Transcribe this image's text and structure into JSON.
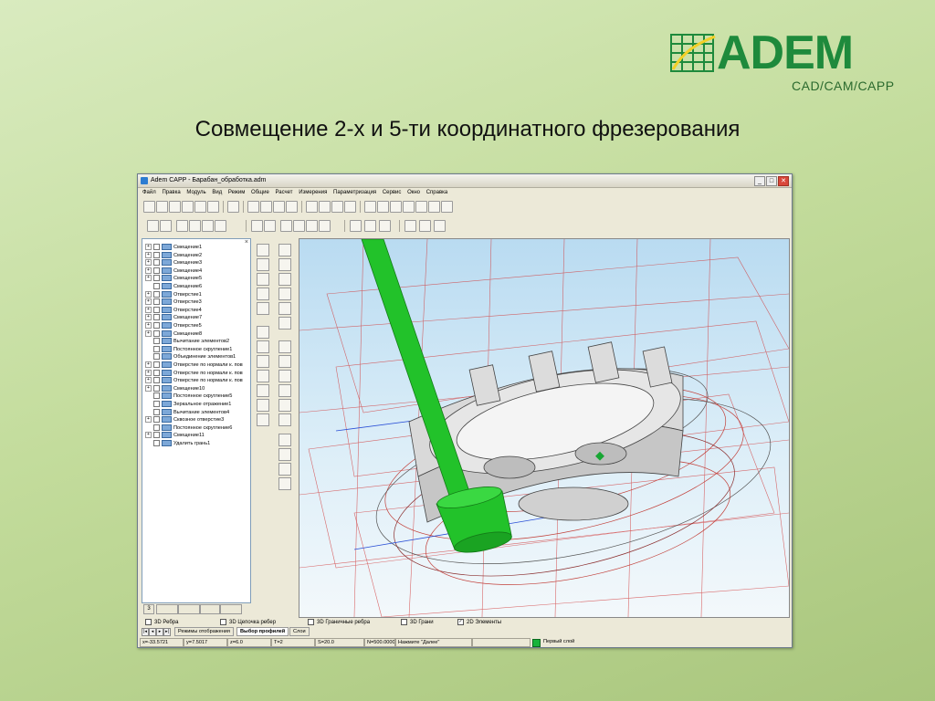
{
  "logo": {
    "name": "ADEM",
    "subtitle": "CAD/CAM/CAPP",
    "brand_color": "#1e8a3c"
  },
  "slide_title": "Совмещение 2-х и 5-ти координатного фрезерования",
  "window": {
    "title": "Adem CAPP - Барабан_обработка.adm",
    "controls": [
      "_",
      "□",
      "✕"
    ]
  },
  "menu": [
    "Файл",
    "Правка",
    "Модуль",
    "Вид",
    "Режим",
    "Общие",
    "Расчет",
    "Измерения",
    "Параметризация",
    "Сервис",
    "Окно",
    "Справка"
  ],
  "tree": {
    "items": [
      {
        "label": "Смещение1",
        "expandable": true
      },
      {
        "label": "Смещение2",
        "expandable": true
      },
      {
        "label": "Смещение3",
        "expandable": true
      },
      {
        "label": "Смещение4",
        "expandable": true
      },
      {
        "label": "Смещение5",
        "expandable": true
      },
      {
        "label": "Смещение6",
        "expandable": false
      },
      {
        "label": "Отверстие1",
        "expandable": true
      },
      {
        "label": "Отверстие3",
        "expandable": true
      },
      {
        "label": "Отверстие4",
        "expandable": true
      },
      {
        "label": "Смещение7",
        "expandable": true
      },
      {
        "label": "Отверстие5",
        "expandable": true
      },
      {
        "label": "Смещение8",
        "expandable": true
      },
      {
        "label": "Вычитание элементов2",
        "expandable": false
      },
      {
        "label": "Постоянное скругление1",
        "expandable": false
      },
      {
        "label": "Объединение элементов1",
        "expandable": false
      },
      {
        "label": "Отверстие по нормали к. пов",
        "expandable": true
      },
      {
        "label": "Отверстие по нормали к. пов",
        "expandable": true
      },
      {
        "label": "Отверстие по нормали к. пов",
        "expandable": true
      },
      {
        "label": "Смещение10",
        "expandable": true
      },
      {
        "label": "Постоянное скругление5",
        "expandable": false
      },
      {
        "label": "Зеркальное отражение1",
        "expandable": false
      },
      {
        "label": "Вычитание элементов4",
        "expandable": false
      },
      {
        "label": "Сквозное отверстие3",
        "expandable": true
      },
      {
        "label": "Постоянное скругление6",
        "expandable": false
      },
      {
        "label": "Смещение11",
        "expandable": true
      },
      {
        "label": "Удалить грань1",
        "expandable": false
      }
    ],
    "tab_label": "3"
  },
  "filters": [
    {
      "label": "3D Ребра",
      "checked": false
    },
    {
      "label": "3D Цепочка ребер",
      "checked": false
    },
    {
      "label": "3D Граничные ребра",
      "checked": false
    },
    {
      "label": "3D Грани",
      "checked": false
    },
    {
      "label": "2D Элементы",
      "checked": true
    }
  ],
  "view_tabs": [
    "Режимы отображения",
    "Выбор профилей",
    "Слои"
  ],
  "status": {
    "x": "x=-33.5721",
    "y": "y=7.5017",
    "z": "z=6.0",
    "t": "T=2",
    "s": "S=20.0",
    "n": "N=500.0000",
    "hint": "Нажмите \"Далее\"",
    "layer": "Первый слой",
    "layer_color": "#17b33b"
  },
  "colors": {
    "tool": "#22c22a",
    "wireframe_red": "#d23a3a"
  }
}
